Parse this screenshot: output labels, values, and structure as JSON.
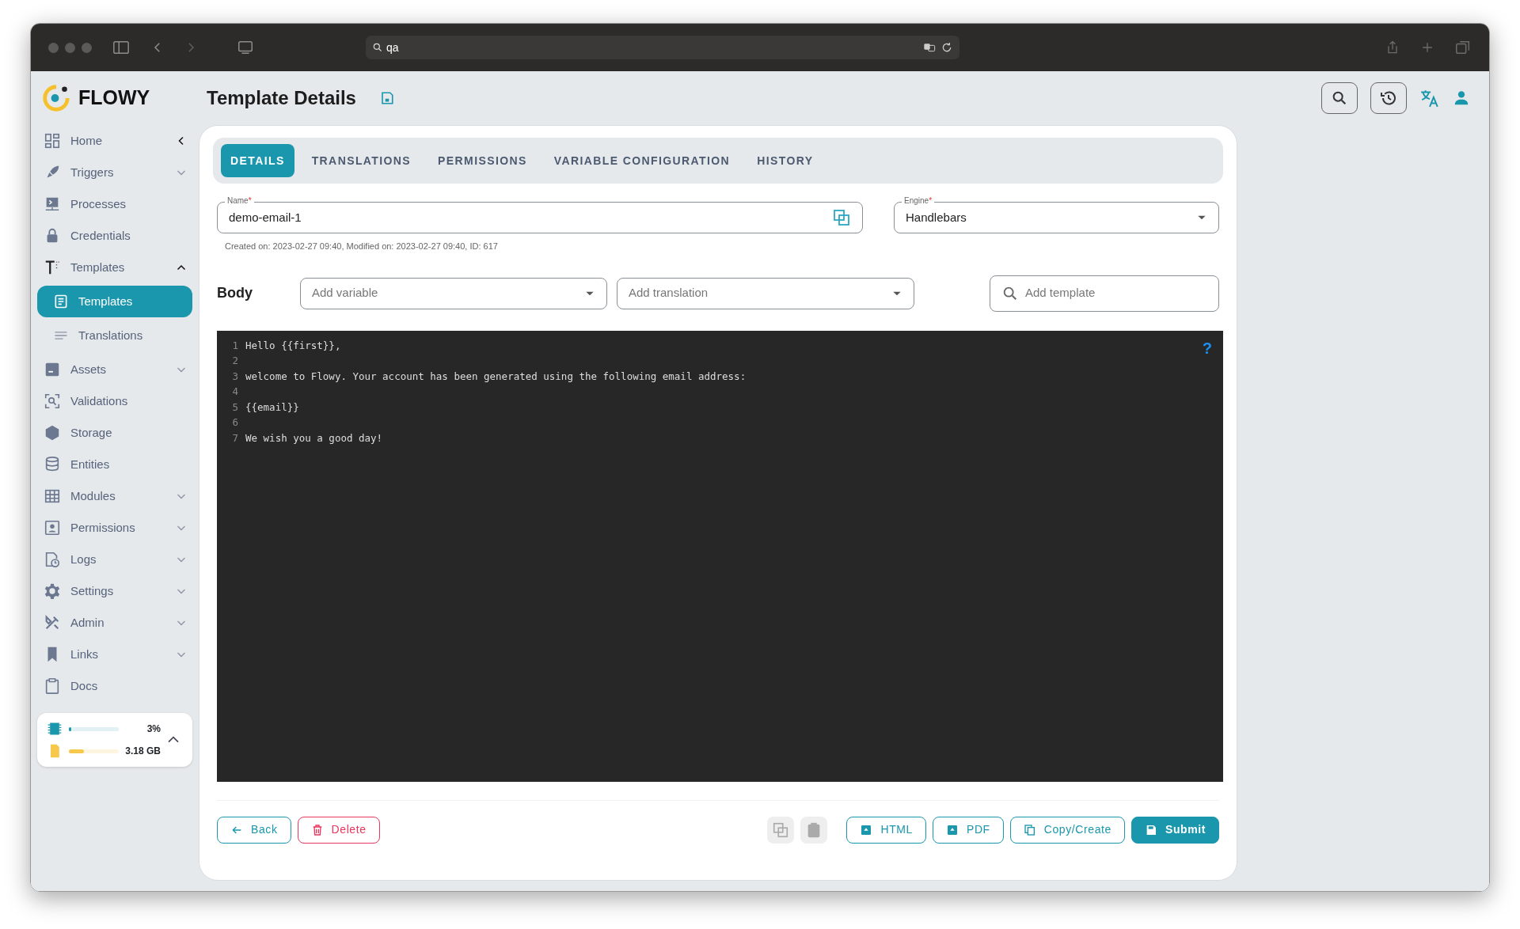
{
  "browser": {
    "address": "qa"
  },
  "app": {
    "logo": "FLOWY",
    "page_title": "Template Details"
  },
  "sidebar": {
    "items": [
      {
        "label": "Home"
      },
      {
        "label": "Triggers",
        "expanded": false
      },
      {
        "label": "Processes"
      },
      {
        "label": "Credentials"
      },
      {
        "label": "Templates",
        "expanded": true,
        "children": [
          {
            "label": "Templates",
            "selected": true
          },
          {
            "label": "Translations",
            "selected": false
          }
        ]
      },
      {
        "label": "Assets",
        "expanded": false
      },
      {
        "label": "Validations"
      },
      {
        "label": "Storage"
      },
      {
        "label": "Entities"
      },
      {
        "label": "Modules",
        "expanded": false
      },
      {
        "label": "Permissions",
        "expanded": false
      },
      {
        "label": "Logs",
        "expanded": false
      },
      {
        "label": "Settings",
        "expanded": false
      },
      {
        "label": "Admin",
        "expanded": false
      },
      {
        "label": "Links",
        "expanded": false
      },
      {
        "label": "Docs"
      }
    ],
    "resources": [
      {
        "kind": "cpu",
        "level": 0.03,
        "reading": "3%"
      },
      {
        "kind": "disk",
        "level": 0.3,
        "reading": "3.18 GB"
      }
    ]
  },
  "tabs": [
    {
      "label": "DETAILS",
      "selected": true
    },
    {
      "label": "TRANSLATIONS",
      "selected": false
    },
    {
      "label": "PERMISSIONS",
      "selected": false
    },
    {
      "label": "VARIABLE CONFIGURATION",
      "selected": false
    },
    {
      "label": "HISTORY",
      "selected": false
    }
  ],
  "form": {
    "name": {
      "label": "Name",
      "required_mark": "*",
      "value": "demo-email-1"
    },
    "engine": {
      "label": "Engine",
      "required_mark": "*",
      "value": "Handlebars"
    },
    "meta": "Created on: 2023-02-27 09:40, Modified on: 2023-02-27 09:40, ID: 617",
    "body_label": "Body",
    "add_variable": {
      "placeholder": "Add variable"
    },
    "add_translation": {
      "placeholder": "Add translation"
    },
    "add_template": {
      "placeholder": "Add template"
    }
  },
  "editor": {
    "help": "?",
    "lines": [
      {
        "number": "1",
        "text": "Hello {{first}},"
      },
      {
        "number": "2"
      },
      {
        "number": "3",
        "text": "welcome to Flowy. Your account has been generated using the following email address:"
      },
      {
        "number": "4"
      },
      {
        "number": "5",
        "text": "{{email}}"
      },
      {
        "number": "6"
      },
      {
        "number": "7",
        "text": "We wish you a good day!"
      }
    ]
  },
  "footer_buttons": [
    {
      "kind": "back",
      "label": "Back"
    },
    {
      "kind": "delete",
      "label": "Delete"
    },
    {
      "kind": "icon-copy",
      "disabled": true
    },
    {
      "kind": "icon-paste",
      "disabled": true
    },
    {
      "kind": "export",
      "label": "HTML"
    },
    {
      "kind": "export",
      "label": "PDF"
    },
    {
      "kind": "copy",
      "label": "Copy/Create"
    },
    {
      "kind": "submit",
      "label": "Submit"
    }
  ]
}
